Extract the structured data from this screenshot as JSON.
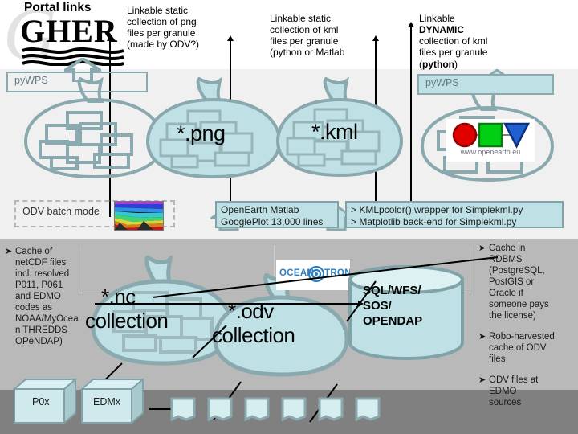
{
  "logo": {
    "title": "Portal links",
    "wordmark": "GHER",
    "watermark": "G"
  },
  "annotations": {
    "png_note": [
      "Linkable static",
      "collection of png",
      "files per granule",
      "(made by ODV?)"
    ],
    "kml_static_note": [
      "Linkable static",
      "collection of kml",
      "files per granule",
      "(python or Matlab"
    ],
    "kml_dynamic_note_1": "Linkable",
    "kml_dynamic_note_2": "DYNAMIC",
    "kml_dynamic_note_3": [
      "collection of kml",
      "files per granule"
    ],
    "kml_dynamic_note_4_pre": "(",
    "kml_dynamic_note_4_bold": "python",
    "kml_dynamic_note_4_post": ")"
  },
  "wps": {
    "left_label": "pyWPS",
    "right_label": "pyWPS"
  },
  "bags": {
    "nc_files": "",
    "png": "*.png",
    "kml": "*.kml",
    "openearth": "",
    "nc_collection_line1": "*.nc",
    "nc_collection_line2": "collection",
    "odv_collection_line1": "*.odv",
    "odv_collection_line2": "collection"
  },
  "tools": {
    "odv_batch_mode": "ODV batch mode",
    "openearth_box": [
      "OpenEarth Matlab",
      "GooglePlot 13,000 lines"
    ],
    "simplekml_box": [
      "> KMLpcolor() wrapper for Simplekml.py",
      "> Matplotlib back-end for Simplekml.py"
    ]
  },
  "openearth_logo": {
    "url": "www.openearth.eu",
    "shape_red": "circle",
    "shape_green": "square",
    "shape_blue": "triangle"
  },
  "oceanotron": {
    "text_left": "OCEAN",
    "text_right": "TRON"
  },
  "database": {
    "lines": [
      "SQL/WFS/",
      "SOS/",
      "OPENDAP"
    ]
  },
  "cubes": [
    {
      "label": "P0x"
    },
    {
      "label": "EDMx"
    }
  ],
  "left_bullets": [
    {
      "glyph": "➤",
      "lines": [
        "Cache of",
        "netCDF files",
        "incl. resolved",
        "P011, P061",
        "and EDMO",
        "codes as",
        "NOAA/MyOcea",
        "n THREDDS",
        "OPeNDAP)"
      ]
    }
  ],
  "right_bullets": [
    {
      "glyph": "➤",
      "lines": [
        "Cache in",
        "RDBMS",
        "(PostgreSQL,",
        "PostGIS or",
        "Oracle if",
        "someone pays",
        "the license)"
      ]
    },
    {
      "glyph": "➤",
      "lines": [
        "Robo-harvested",
        "cache of ODV",
        "files"
      ]
    },
    {
      "glyph": "➤",
      "lines": [
        "ODV files at",
        "EDMO",
        "sources"
      ]
    }
  ],
  "colors": {
    "bag_fill": "#bfe0e4",
    "bag_stroke": "#8aa9ae",
    "band_light": "#f0f0f0",
    "band_mid": "#b9b9b9",
    "band_dark": "#808080",
    "accent_blue": "#2f7fc1"
  }
}
